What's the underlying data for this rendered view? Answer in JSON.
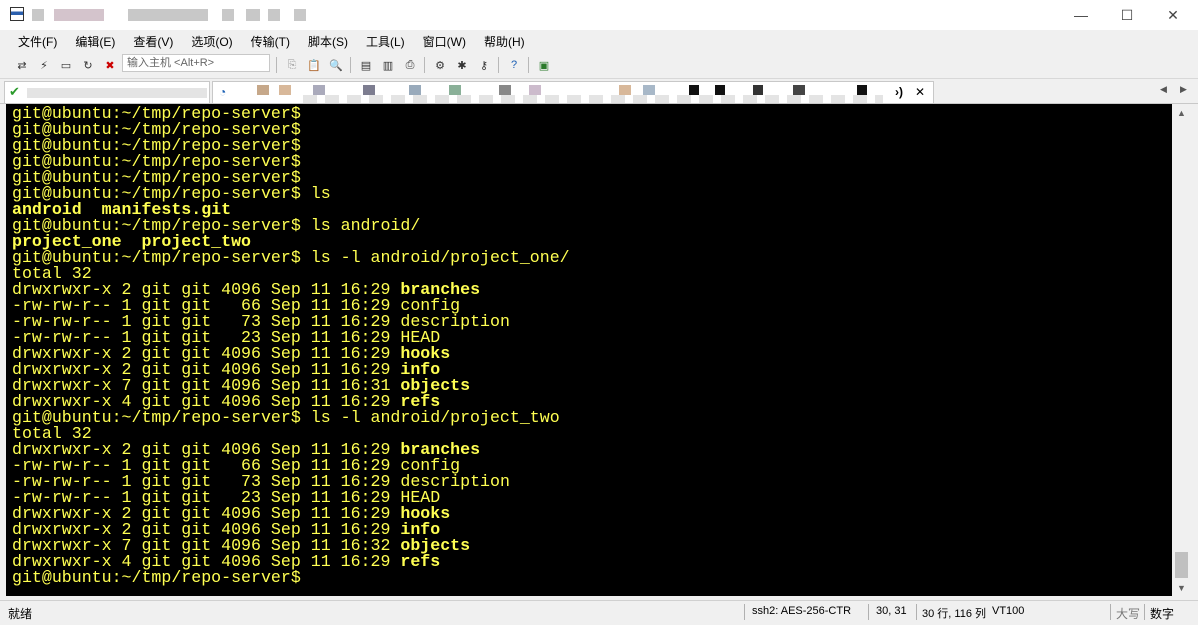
{
  "menu": [
    "文件(F)",
    "编辑(E)",
    "查看(V)",
    "选项(O)",
    "传输(T)",
    "脚本(S)",
    "工具(L)",
    "窗口(W)",
    "帮助(H)"
  ],
  "toolbar": {
    "host_placeholder": "输入主机 <Alt+R>"
  },
  "tabs": {
    "close_label": "✕",
    "prev_label": "◀",
    "next_label": "▶",
    "active_suffix": "›)"
  },
  "terminal": {
    "lines": [
      {
        "text": "git@ubuntu:~/tmp/repo-server$",
        "bold": false
      },
      {
        "text": "git@ubuntu:~/tmp/repo-server$",
        "bold": false
      },
      {
        "text": "git@ubuntu:~/tmp/repo-server$",
        "bold": false
      },
      {
        "text": "git@ubuntu:~/tmp/repo-server$",
        "bold": false
      },
      {
        "text": "git@ubuntu:~/tmp/repo-server$",
        "bold": false
      },
      {
        "text": "git@ubuntu:~/tmp/repo-server$ ls",
        "bold": false
      },
      {
        "text": "android  manifests.git",
        "bold": true
      },
      {
        "text": "git@ubuntu:~/tmp/repo-server$ ls android/",
        "bold": false
      },
      {
        "text": "project_one  project_two",
        "bold": true
      },
      {
        "text": "git@ubuntu:~/tmp/repo-server$ ls -l android/project_one/",
        "bold": false
      },
      {
        "text": "total 32",
        "bold": false
      },
      {
        "prefix": "drwxrwxr-x 2 git git 4096 Sep 11 16:29 ",
        "name": "branches",
        "bold_name": true
      },
      {
        "prefix": "-rw-rw-r-- 1 git git   66 Sep 11 16:29 ",
        "name": "config",
        "bold_name": false
      },
      {
        "prefix": "-rw-rw-r-- 1 git git   73 Sep 11 16:29 ",
        "name": "description",
        "bold_name": false
      },
      {
        "prefix": "-rw-rw-r-- 1 git git   23 Sep 11 16:29 ",
        "name": "HEAD",
        "bold_name": false
      },
      {
        "prefix": "drwxrwxr-x 2 git git 4096 Sep 11 16:29 ",
        "name": "hooks",
        "bold_name": true
      },
      {
        "prefix": "drwxrwxr-x 2 git git 4096 Sep 11 16:29 ",
        "name": "info",
        "bold_name": true
      },
      {
        "prefix": "drwxrwxr-x 7 git git 4096 Sep 11 16:31 ",
        "name": "objects",
        "bold_name": true
      },
      {
        "prefix": "drwxrwxr-x 4 git git 4096 Sep 11 16:29 ",
        "name": "refs",
        "bold_name": true
      },
      {
        "text": "git@ubuntu:~/tmp/repo-server$ ls -l android/project_two",
        "bold": false
      },
      {
        "text": "total 32",
        "bold": false
      },
      {
        "prefix": "drwxrwxr-x 2 git git 4096 Sep 11 16:29 ",
        "name": "branches",
        "bold_name": true
      },
      {
        "prefix": "-rw-rw-r-- 1 git git   66 Sep 11 16:29 ",
        "name": "config",
        "bold_name": false
      },
      {
        "prefix": "-rw-rw-r-- 1 git git   73 Sep 11 16:29 ",
        "name": "description",
        "bold_name": false
      },
      {
        "prefix": "-rw-rw-r-- 1 git git   23 Sep 11 16:29 ",
        "name": "HEAD",
        "bold_name": false
      },
      {
        "prefix": "drwxrwxr-x 2 git git 4096 Sep 11 16:29 ",
        "name": "hooks",
        "bold_name": true
      },
      {
        "prefix": "drwxrwxr-x 2 git git 4096 Sep 11 16:29 ",
        "name": "info",
        "bold_name": true
      },
      {
        "prefix": "drwxrwxr-x 7 git git 4096 Sep 11 16:32 ",
        "name": "objects",
        "bold_name": true
      },
      {
        "prefix": "drwxrwxr-x 4 git git 4096 Sep 11 16:29 ",
        "name": "refs",
        "bold_name": true
      },
      {
        "text": "git@ubuntu:~/tmp/repo-server$",
        "bold": false
      }
    ]
  },
  "status": {
    "ready": "就绪",
    "protocol": "ssh2: AES-256-CTR",
    "cursor": "30, 31",
    "size": "30 行, 116 列",
    "emulation": "VT100",
    "caps": "大写",
    "num": "数字"
  },
  "window_buttons": {
    "minimize": "—",
    "maximize": "☐",
    "close": "✕"
  },
  "colors": {
    "terminal_bg": "#000000",
    "terminal_fg": "#ffff52"
  }
}
